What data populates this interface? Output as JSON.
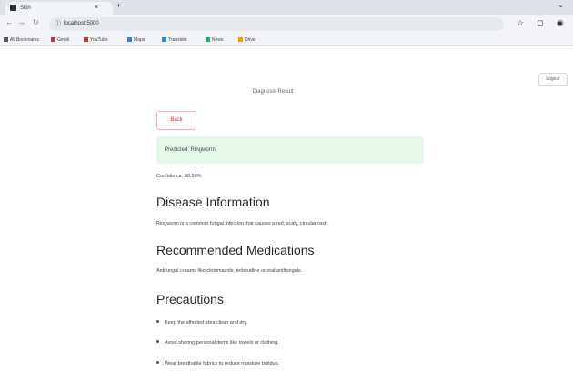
{
  "browser": {
    "tab_title": "Skin",
    "tab_close": "×",
    "new_tab": "+",
    "window_control": "⌄",
    "url": "localhost:5000",
    "nav": {
      "back": "←",
      "forward": "→",
      "reload": "↻"
    },
    "right_icons": [
      "☆",
      "◻",
      "◉"
    ],
    "bookmarks": [
      {
        "label": "All Bookmarks",
        "color": "#5a5a5a"
      },
      {
        "label": "Gmail",
        "color": "#c0392b"
      },
      {
        "label": "YouTube",
        "color": "#c0392b"
      },
      {
        "label": "Maps",
        "color": "#2e86de"
      },
      {
        "label": "Translate",
        "color": "#2e86de"
      },
      {
        "label": "News",
        "color": "#27ae60"
      },
      {
        "label": "Drive",
        "color": "#f39c12"
      }
    ]
  },
  "page": {
    "logout_label": "Logout",
    "heading": "Diagnosis Result",
    "back_label": "Back",
    "result_text": "Predicted: Ringworm",
    "confidence_text": "Confidence: 98.56%",
    "disease_title": "Disease Information",
    "disease_text": "Ringworm is a common fungal infection that causes a red, scaly, circular rash.",
    "meds_title": "Recommended Medications",
    "meds_text": "Antifungal creams like clotrimazole, terbinafine or oral antifungals.",
    "precautions_title": "Precautions",
    "precautions": [
      "Keep the affected area clean and dry.",
      "Avoid sharing personal items like towels or clothing.",
      "Wear breathable fabrics to reduce moisture buildup."
    ]
  }
}
